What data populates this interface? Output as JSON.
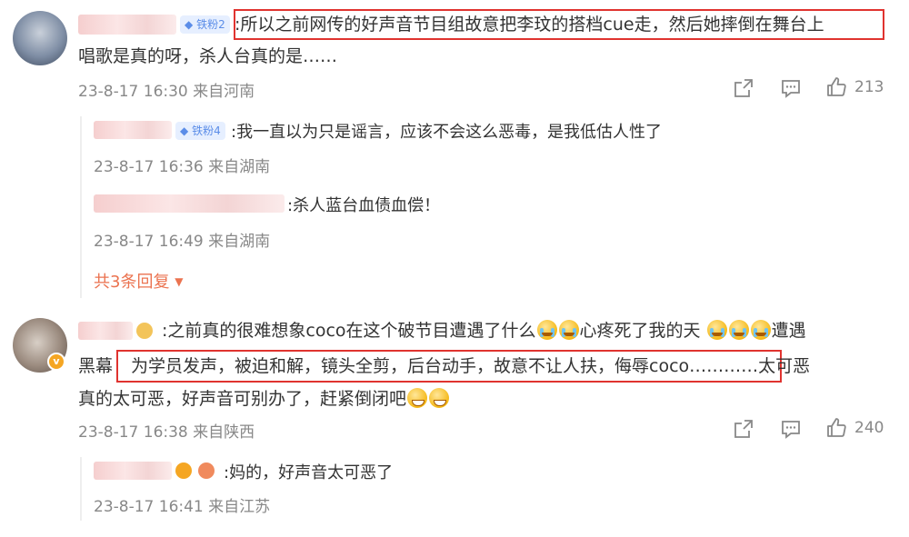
{
  "comments": [
    {
      "fan_badge": "铁粉2",
      "text_line1": ":所以之前网传的好声音节目组故意把李玟的搭档cue走，然后她摔倒在舞台上",
      "text_line2": "唱歌是真的呀，杀人台真的是……",
      "meta": "23-8-17 16:30 来自河南",
      "likes": "213",
      "replies": [
        {
          "fan_badge": "铁粉4",
          "text": ":我一直以为只是谣言，应该不会这么恶毒，是我低估人性了",
          "meta": "23-8-17 16:36 来自湖南"
        },
        {
          "text": ":杀人蓝台血债血偿！",
          "meta": "23-8-17 16:49 来自湖南"
        }
      ],
      "more_replies": "共3条回复"
    },
    {
      "text_line1_a": ":之前真的很难想象coco在这个破节目遭遇了什么",
      "text_line1_b": "心疼死了我的天",
      "text_line1_c": "遭遇",
      "text_line2_a": "黑幕",
      "text_line2_boxed": "为学员发声，被迫和解，镜头全剪，后台动手，故意不让人扶，侮辱coco……",
      "text_line2_c": "……太可恶",
      "text_line3": "真的太可恶，好声音可别办了，赶紧倒闭吧",
      "meta": "23-8-17 16:38 来自陕西",
      "likes": "240",
      "replies": [
        {
          "text": ":妈的，好声音太可恶了",
          "meta": "23-8-17 16:41 来自江苏"
        }
      ]
    }
  ],
  "icons": {
    "share": "share-icon",
    "comment": "comment-icon",
    "like": "like-icon"
  },
  "colors": {
    "highlight_box": "#e0332f",
    "meta_text": "#888888",
    "more_link": "#eb7350",
    "fan_badge_text": "#5b8de8"
  }
}
